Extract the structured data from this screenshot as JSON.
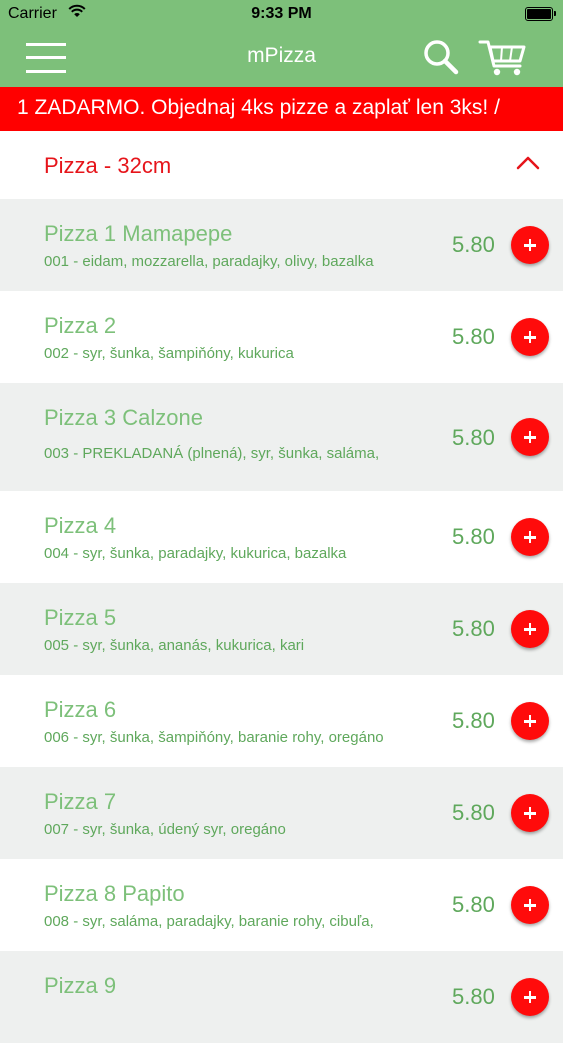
{
  "status_bar": {
    "carrier": "Carrier",
    "time": "9:33 PM",
    "icons": [
      "wifi-icon",
      "battery-icon"
    ]
  },
  "nav": {
    "title": "mPizza",
    "icons": [
      "hamburger-menu-icon",
      "search-icon",
      "cart-icon"
    ]
  },
  "banner": {
    "text": "1 ZADARMO. Objednaj 4ks pizze a zaplať len 3ks!   /"
  },
  "section": {
    "title": "Pizza - 32cm",
    "icon": "chevron-up-icon"
  },
  "colors": {
    "brand_green": "#7dc07a",
    "text_green": "#5fa85c",
    "accent_red": "#ff0000",
    "row_gray": "#eef0ef"
  },
  "items": [
    {
      "name": "Pizza 1 Mamapepe",
      "desc": "001 - eidam, mozzarella, paradajky, olivy, bazalka",
      "price": "5.80"
    },
    {
      "name": "Pizza 2",
      "desc": "002 - syr, šunka, šampiňóny, kukurica",
      "price": "5.80"
    },
    {
      "name": "Pizza 3 Calzone",
      "desc": "003 - PREKLADANÁ (plnená), syr, šunka, saláma,",
      "price": "5.80"
    },
    {
      "name": "Pizza 4",
      "desc": "004 - syr, šunka, paradajky, kukurica, bazalka",
      "price": "5.80"
    },
    {
      "name": "Pizza 5",
      "desc": "005 - syr, šunka, ananás, kukurica, kari",
      "price": "5.80"
    },
    {
      "name": "Pizza 6",
      "desc": "006 - syr, šunka, šampiňóny, baranie rohy, oregáno",
      "price": "5.80"
    },
    {
      "name": "Pizza 7",
      "desc": "007 - syr, šunka, údený syr, oregáno",
      "price": "5.80"
    },
    {
      "name": "Pizza 8 Papito",
      "desc": "008 - syr, saláma, paradajky, baranie rohy, cibuľa,",
      "price": "5.80"
    },
    {
      "name": "Pizza 9",
      "desc": "",
      "price": "5.80"
    }
  ]
}
